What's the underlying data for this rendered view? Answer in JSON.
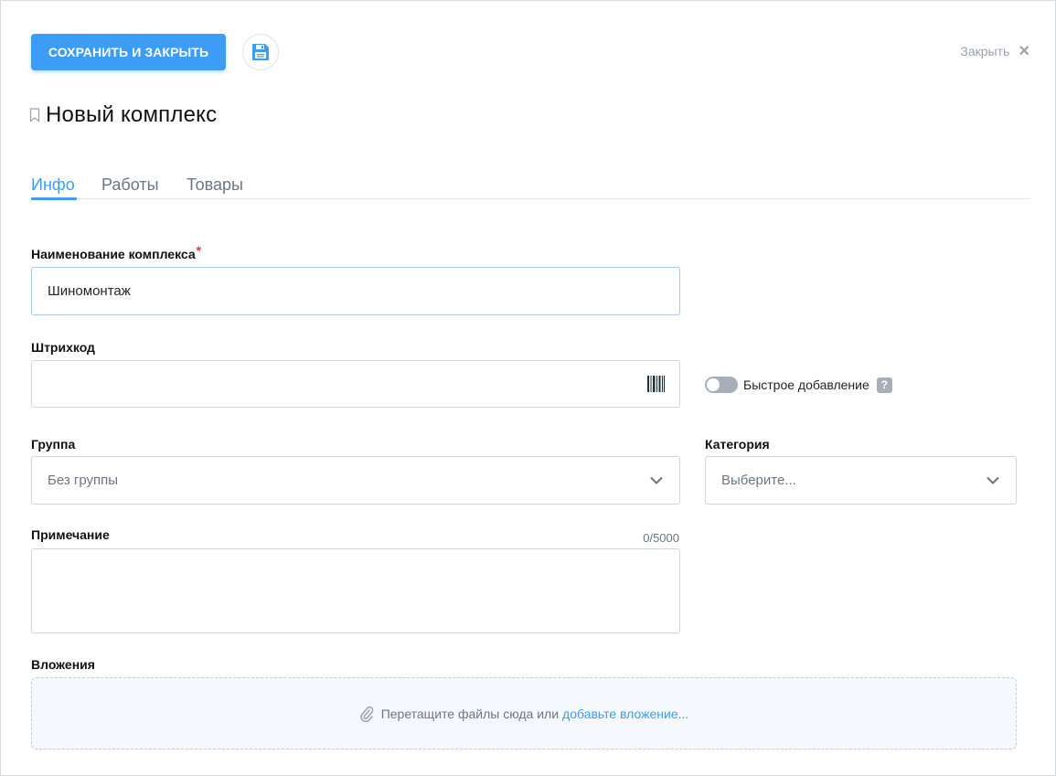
{
  "toolbar": {
    "save_close_label": "СОХРАНИТЬ И ЗАКРЫТЬ",
    "close_label": "Закрыть",
    "close_icon": "×"
  },
  "page": {
    "title": "Новый комплекс"
  },
  "tabs": [
    {
      "label": "Инфо",
      "active": true
    },
    {
      "label": "Работы",
      "active": false
    },
    {
      "label": "Товары",
      "active": false
    }
  ],
  "form": {
    "name": {
      "label": "Наименование комплекса",
      "required_mark": "*",
      "value": "Шиномонтаж"
    },
    "barcode": {
      "label": "Штрихкод",
      "value": ""
    },
    "quick_add": {
      "label": "Быстрое добавление",
      "help": "?",
      "enabled": false
    },
    "group": {
      "label": "Группа",
      "value": "Без группы"
    },
    "category": {
      "label": "Категория",
      "placeholder": "Выберите..."
    },
    "note": {
      "label": "Примечание",
      "counter": "0/5000",
      "value": ""
    },
    "attachments": {
      "label": "Вложения",
      "drop_text": "Перетащите файлы сюда или",
      "link_text": "добавьте вложение..."
    }
  },
  "colors": {
    "accent": "#3d9cf5",
    "required": "#e53935",
    "muted": "#6b7682"
  }
}
